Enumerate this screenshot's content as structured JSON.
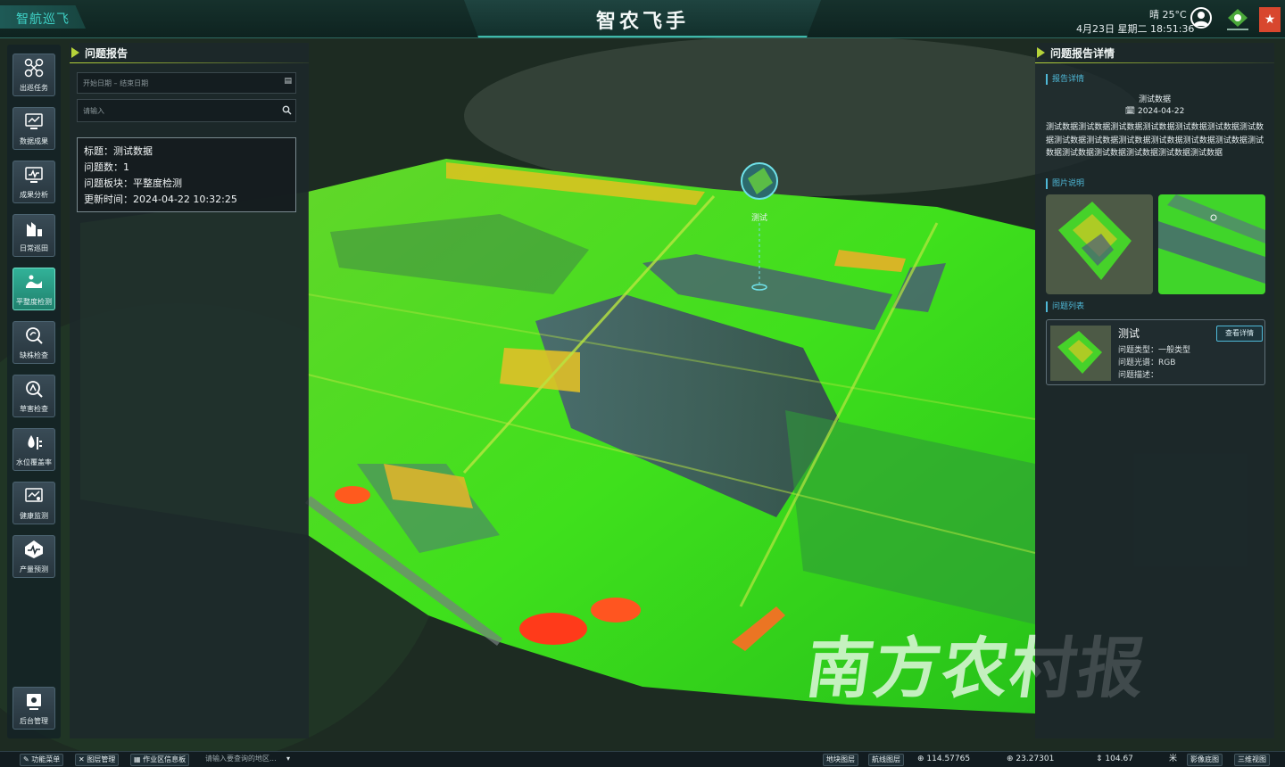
{
  "header": {
    "brand": "智航巡飞",
    "app_title": "智农飞手",
    "weather": "晴 25°C",
    "datetime": "4月23日 星期二 18:51:36"
  },
  "nav": {
    "items": [
      {
        "label": "出巡任务",
        "icon": "drone-icon",
        "active": false
      },
      {
        "label": "数据成果",
        "icon": "chart-monitor-icon",
        "active": false
      },
      {
        "label": "成果分析",
        "icon": "analysis-monitor-icon",
        "active": false
      },
      {
        "label": "日常巡田",
        "icon": "field-patrol-icon",
        "active": false
      },
      {
        "label": "平整度检测",
        "icon": "flatness-icon",
        "active": true
      },
      {
        "label": "缺株检查",
        "icon": "plant-search-icon",
        "active": false
      },
      {
        "label": "草害检查",
        "icon": "weed-search-icon",
        "active": false
      },
      {
        "label": "水位覆盖率",
        "icon": "water-level-icon",
        "active": false
      },
      {
        "label": "健康监测",
        "icon": "health-monitor-icon",
        "active": false
      },
      {
        "label": "产量预测",
        "icon": "yield-forecast-icon",
        "active": false
      },
      {
        "label": "后台管理",
        "icon": "admin-icon",
        "active": false
      }
    ]
  },
  "left_panel": {
    "title": "问题报告",
    "date_placeholder": "开始日期 – 结束日期",
    "search_placeholder": "请输入",
    "card": {
      "title_row": "标题：测试数据",
      "count_row": "问题数：1",
      "block_row": "问题板块：平整度检测",
      "updated_row": "更新时间：2024-04-22 10:32:25"
    }
  },
  "right_panel": {
    "title": "问题报告详情",
    "report_section": "报告详情",
    "report_title": "测试数据",
    "report_date": "2024-04-22",
    "report_desc": "测试数据测试数据测试数据测试数据测试数据测试数据测试数据测试数据测试数据测试数据测试数据测试数据测试数据测试数据测试数据测试数据测试数据测试数据测试数据",
    "images_section": "图片说明",
    "issues_section": "问题列表",
    "issue": {
      "name": "测试",
      "type": "问题类型：一般类型",
      "spectrum": "问题光谱：RGB",
      "desc": "问题描述：",
      "button": "查看详情"
    }
  },
  "map": {
    "pin_label": "测试",
    "watermark": "南方农村报"
  },
  "bottom_bar": {
    "func_menu": "功能菜单",
    "layer_mgmt": "图层管理",
    "zone_info": "作业区信息板",
    "search_placeholder": "请输入要查询的地区...",
    "plot_layer": "地块图层",
    "route_layer": "航线图层",
    "lon": "114.57765",
    "lat": "23.27301",
    "alt": "104.67",
    "unit": "米",
    "image_base": "影像底图",
    "view_3d": "三维视图"
  }
}
